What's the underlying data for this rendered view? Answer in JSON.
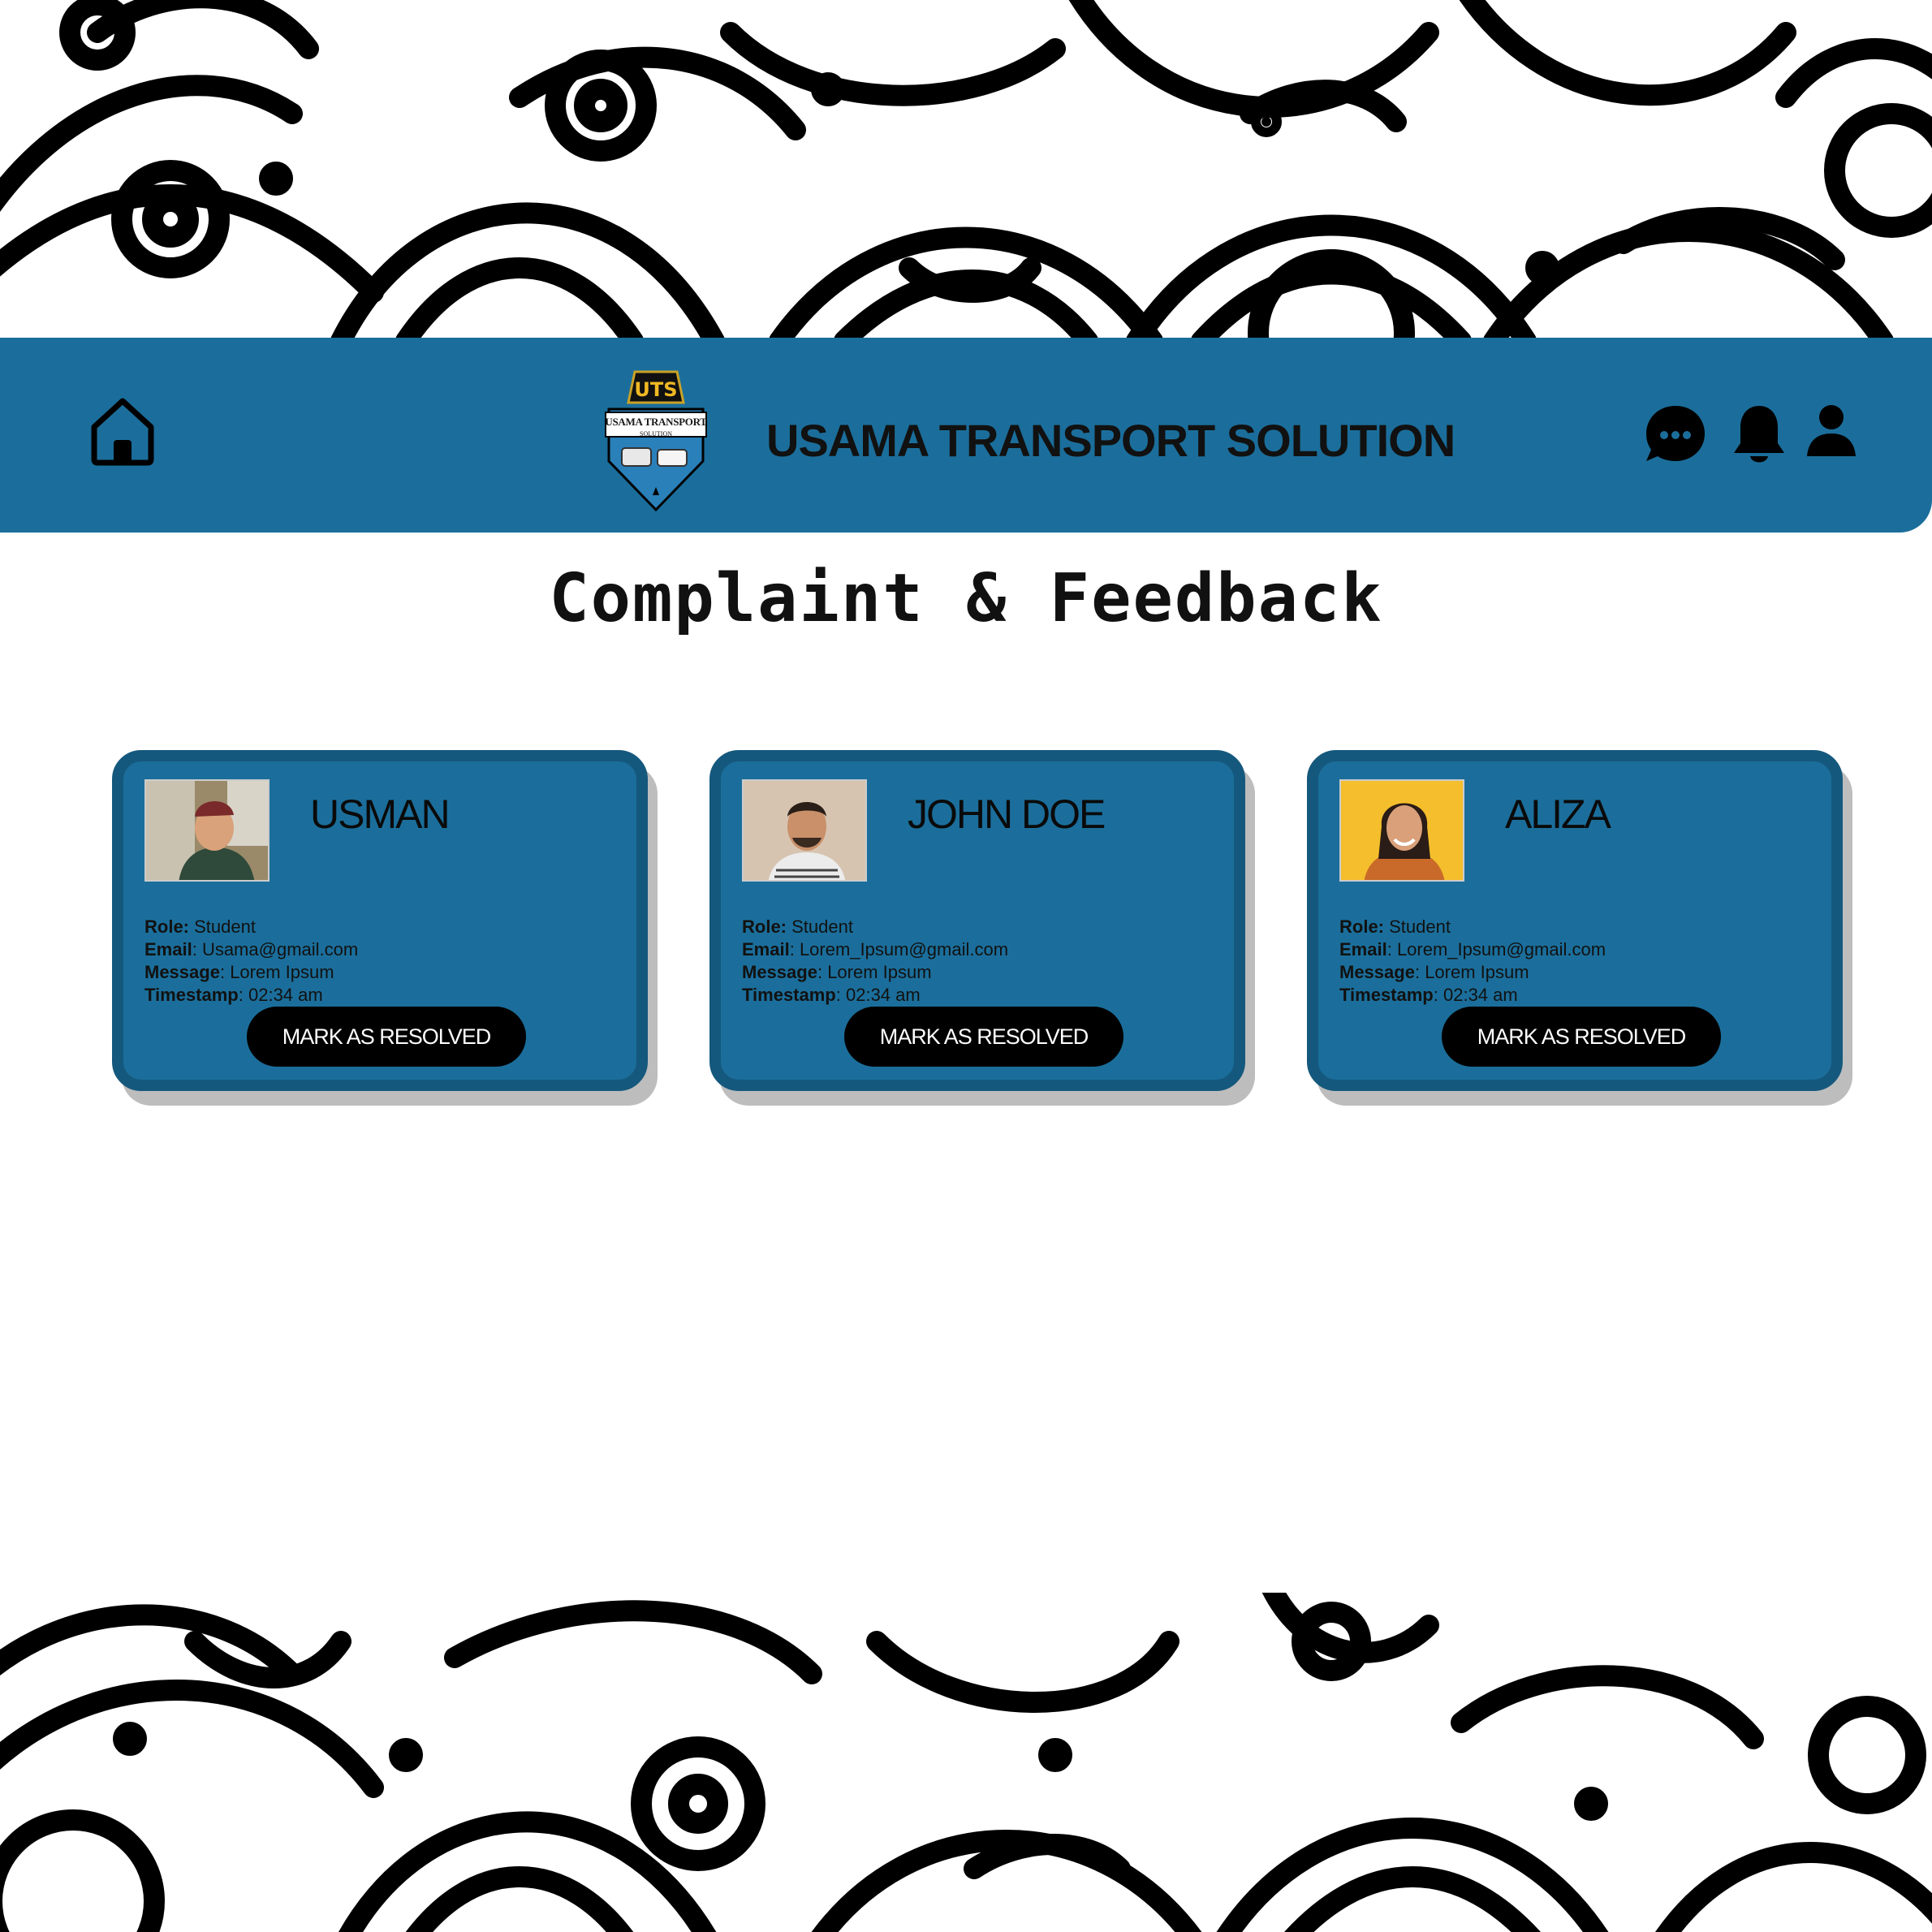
{
  "brand": {
    "logo_letters": "UTS",
    "logo_text": "USAMA TRANSPORT",
    "logo_subtext": "SOLUTION",
    "title": "USAMA TRANSPORT SOLUTION",
    "color": "#1b6e9b"
  },
  "header": {
    "home_icon": "home-icon",
    "chat_icon": "chat-icon",
    "bell_icon": "bell-icon",
    "user_icon": "user-icon"
  },
  "page": {
    "title": "Complaint & Feedback"
  },
  "labels": {
    "role": "Role:",
    "email": "Email",
    "message": "Message",
    "timestamp": "Timestamp"
  },
  "complaints": [
    {
      "name": "USMAN",
      "role": "Student",
      "email": "Usama@gmail.com",
      "message": "Lorem Ipsum",
      "timestamp": "02:34 am",
      "button_label": "MARK AS RESOLVED"
    },
    {
      "name": "JOHN DOE",
      "role": "Student",
      "email": "Lorem_Ipsum@gmail.com",
      "message": "Lorem Ipsum",
      "timestamp": "02:34 am",
      "button_label": "MARK AS RESOLVED"
    },
    {
      "name": "ALIZA",
      "role": "Student",
      "email": "Lorem_Ipsum@gmail.com",
      "message": "Lorem Ipsum",
      "timestamp": "02:34 am",
      "button_label": "MARK AS RESOLVED"
    }
  ]
}
